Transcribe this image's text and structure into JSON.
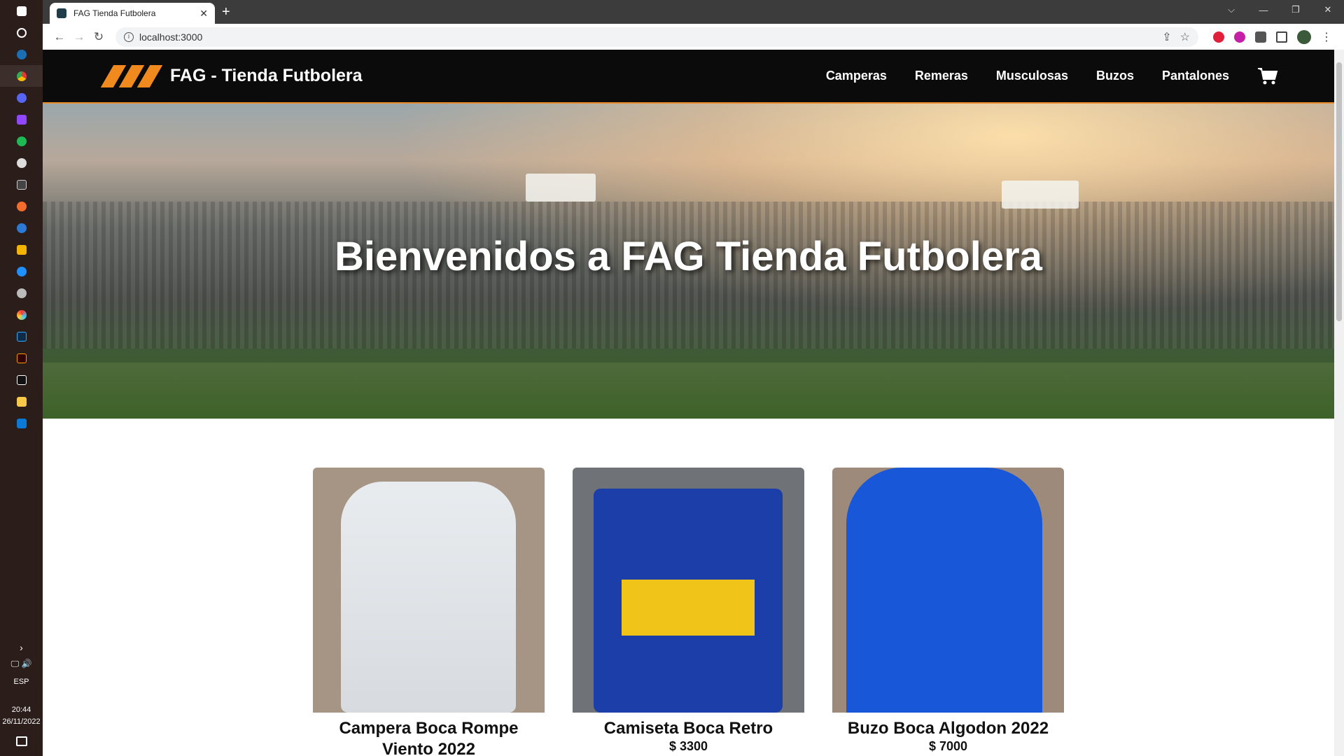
{
  "browser": {
    "tab_title": "FAG Tienda Futbolera",
    "tab_close": "✕",
    "new_tab": "+",
    "url": "localhost:3000",
    "window_controls": [
      "⌵",
      "—",
      "❐",
      "✕"
    ]
  },
  "taskbar": {
    "language": "ESP",
    "time": "20:44",
    "date": "26/11/2022"
  },
  "site": {
    "brand": "FAG - Tienda Futbolera",
    "nav": [
      "Camperas",
      "Remeras",
      "Musculosas",
      "Buzos",
      "Pantalones"
    ],
    "accent_color": "#f08a1f"
  },
  "hero": {
    "title": "Bienvenidos a FAG Tienda Futbolera"
  },
  "products": [
    {
      "name": "Campera Boca Rompe Viento 2022",
      "price": ""
    },
    {
      "name": "Camiseta Boca Retro",
      "price": "$ 3300"
    },
    {
      "name": "Buzo Boca Algodon 2022",
      "price": "$ 7000"
    }
  ]
}
